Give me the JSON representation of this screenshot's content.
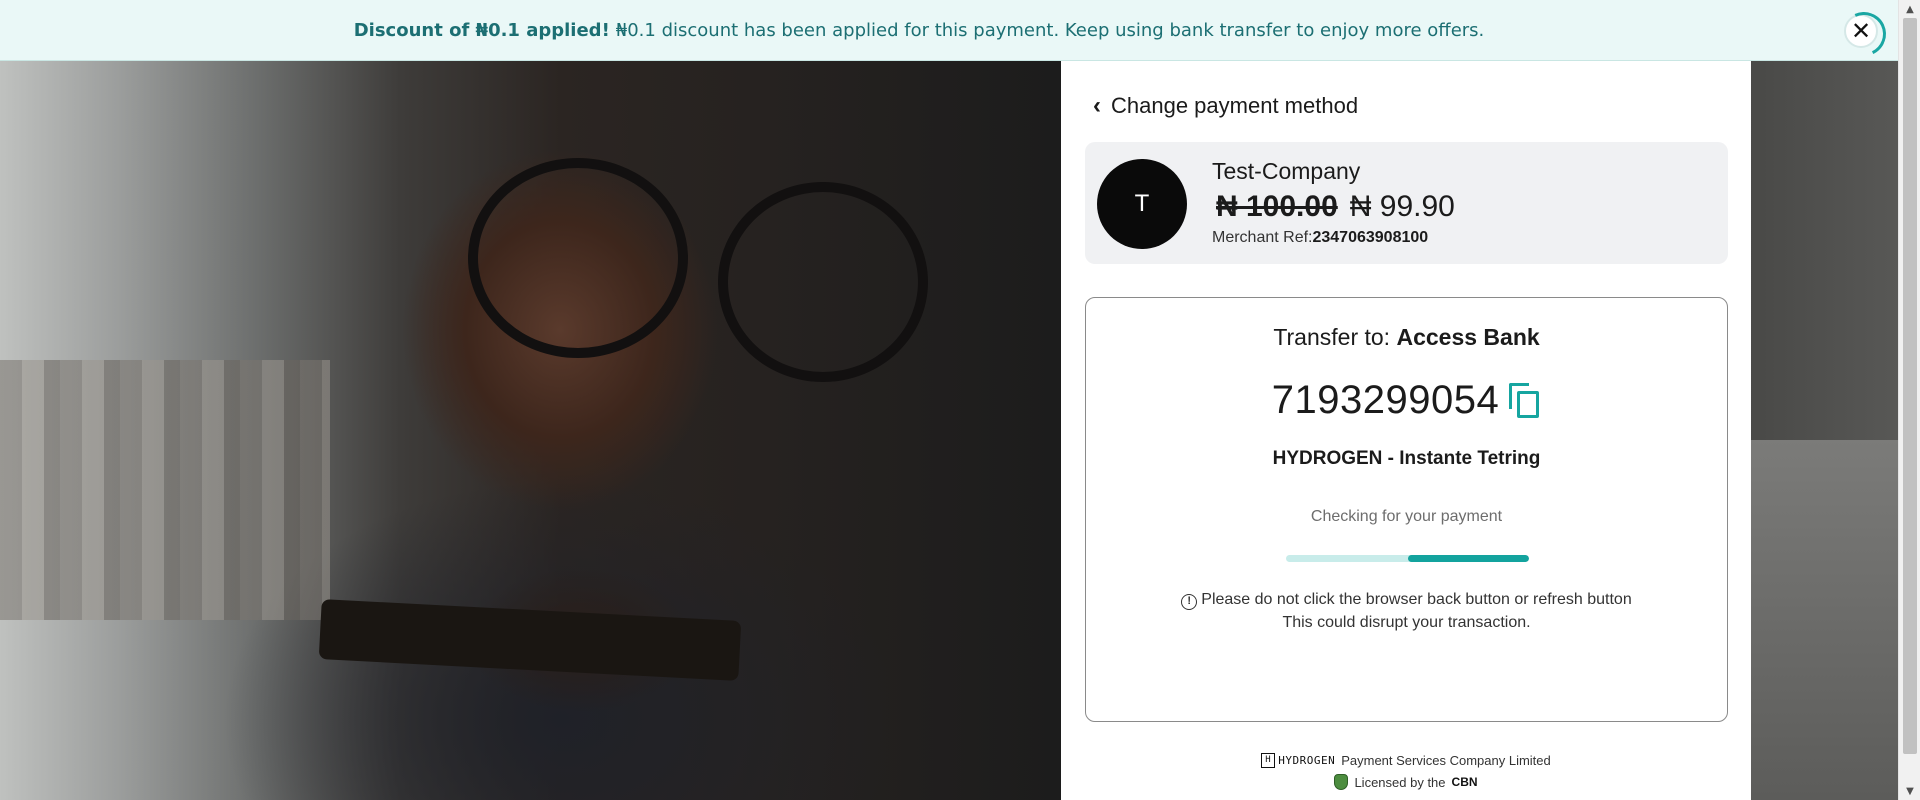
{
  "banner": {
    "title": "Discount of ₦0.1 applied!",
    "message": "₦0.1 discount has been applied for this payment. Keep using bank transfer to enjoy more offers.",
    "close_label": "✕",
    "accent_color": "#1c6f73"
  },
  "payment": {
    "back_label": "Change payment method",
    "merchant": {
      "avatar_initial": "T",
      "name": "Test-Company",
      "original_price": "₦ 100.00",
      "discounted_price": "₦ 99.90",
      "ref_label": "Merchant Ref:",
      "ref_value": "2347063908100"
    },
    "transfer": {
      "to_label": "Transfer to:",
      "bank_name": "Access Bank",
      "account_number": "7193299054",
      "account_name": "HYDROGEN - Instante Tetring",
      "status_text": "Checking for your payment",
      "progress_segment": [
        0.5,
        1.0
      ],
      "warning_line1": "Please do not click the browser back button or refresh button",
      "warning_line2": "This could disrupt your transaction.",
      "accent_color": "#13a39e"
    },
    "footer": {
      "brand": "HYDROGEN",
      "company": "Payment Services Company Limited",
      "licensed_label": "Licensed by the",
      "regulator": "CBN"
    }
  },
  "icons": {
    "back": "chevron-left-icon",
    "copy": "copy-icon",
    "warning": "info-circle-icon",
    "close": "close-icon"
  }
}
